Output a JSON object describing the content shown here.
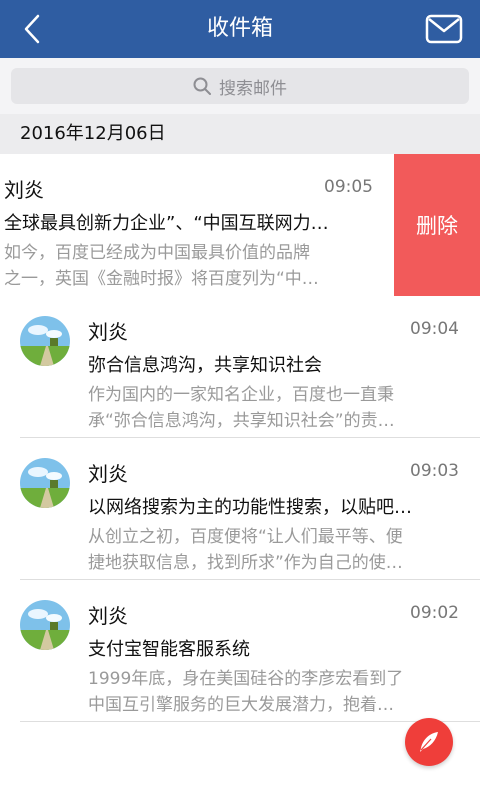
{
  "header": {
    "title": "收件箱"
  },
  "search": {
    "placeholder": "搜索邮件"
  },
  "date_group": "2016年12月06日",
  "swiped_mail": {
    "sender": "刘炎",
    "time": "09:05",
    "subject": "全球最具创新力企业”、“中国互联网力…",
    "preview_line1": "如今，百度已经成为中国最具价值的品牌",
    "preview_line2": "之一，英国《金融时报》将百度列为“中…",
    "delete_label": "删除"
  },
  "mails": [
    {
      "sender": "刘炎",
      "time": "09:04",
      "subject": "弥合信息鸿沟，共享知识社会",
      "preview_line1": "作为国内的一家知名企业，百度也一直秉",
      "preview_line2": "承“弥合信息鸿沟，共享知识社会”的责…"
    },
    {
      "sender": "刘炎",
      "time": "09:03",
      "subject": "以网络搜索为主的功能性搜索，以贴吧…",
      "preview_line1": "从创立之初，百度便将“让人们最平等、便",
      "preview_line2": "捷地获取信息，找到所求”作为自己的使…"
    },
    {
      "sender": "刘炎",
      "time": "09:02",
      "subject": "支付宝智能客服系统",
      "preview_line1": "1999年底，身在美国硅谷的李彦宏看到了",
      "preview_line2": "中国互引擎服务的巨大发展潜力，抱着…"
    }
  ],
  "colors": {
    "header_bg": "#2f5da2",
    "delete_bg": "#f25a5a",
    "fab_bg": "#ef3e3a"
  },
  "icons": [
    "back-arrow-icon",
    "envelope-icon",
    "search-icon",
    "feather-icon"
  ]
}
